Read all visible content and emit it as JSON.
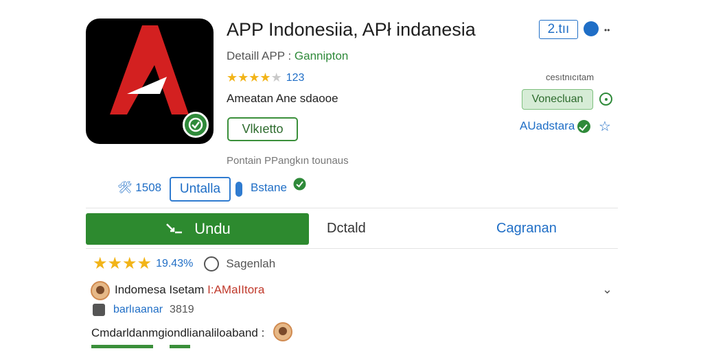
{
  "colors": {
    "accent_blue": "#1f6ec6",
    "brand_green": "#2d8a2f",
    "icon_red": "#d32020",
    "star": "#f2b418"
  },
  "header": {
    "title": "APP Indonesiia, APł indanesia",
    "version": "2.tıı",
    "detail_prefix": "Detaill APP :",
    "developer": "Gannipton",
    "rating_count": "123",
    "rating_stars": 4,
    "side_caption": "cesıtnıcıtam",
    "tagline": "Ameatan Ane sdaooe",
    "badge_label": "Vlkıetto",
    "status_pill": "Vonecluan",
    "publisher": "AUadstara",
    "info_text": "Pontain PPangkın tounaus"
  },
  "stats": {
    "count": "🛠 1508",
    "install_label": "Untalla",
    "secondary_link": "Bstane"
  },
  "tabs": {
    "download_label": "Undu",
    "detail_label": "Dctald",
    "catatan_label": "Cagranan"
  },
  "reviews": {
    "summary_stars": 4,
    "summary_pct": "19.43%",
    "comment_label": "Sagenlah",
    "reviewer_name": "Indomesa Isetam",
    "reviewer_tag": "I:AMaIItora",
    "sub_label": "barlıaanar",
    "sub_count": "3819",
    "comment_text": "Cmdarldanmgiondlianaliloaband :"
  },
  "icons": {
    "app_icon": "red-a-logo-icon",
    "verified": "check-circle-icon",
    "shield": "shield-icon",
    "download": "download-icon",
    "comment": "comment-bubble-icon",
    "chevron": "chevron-down-icon"
  }
}
